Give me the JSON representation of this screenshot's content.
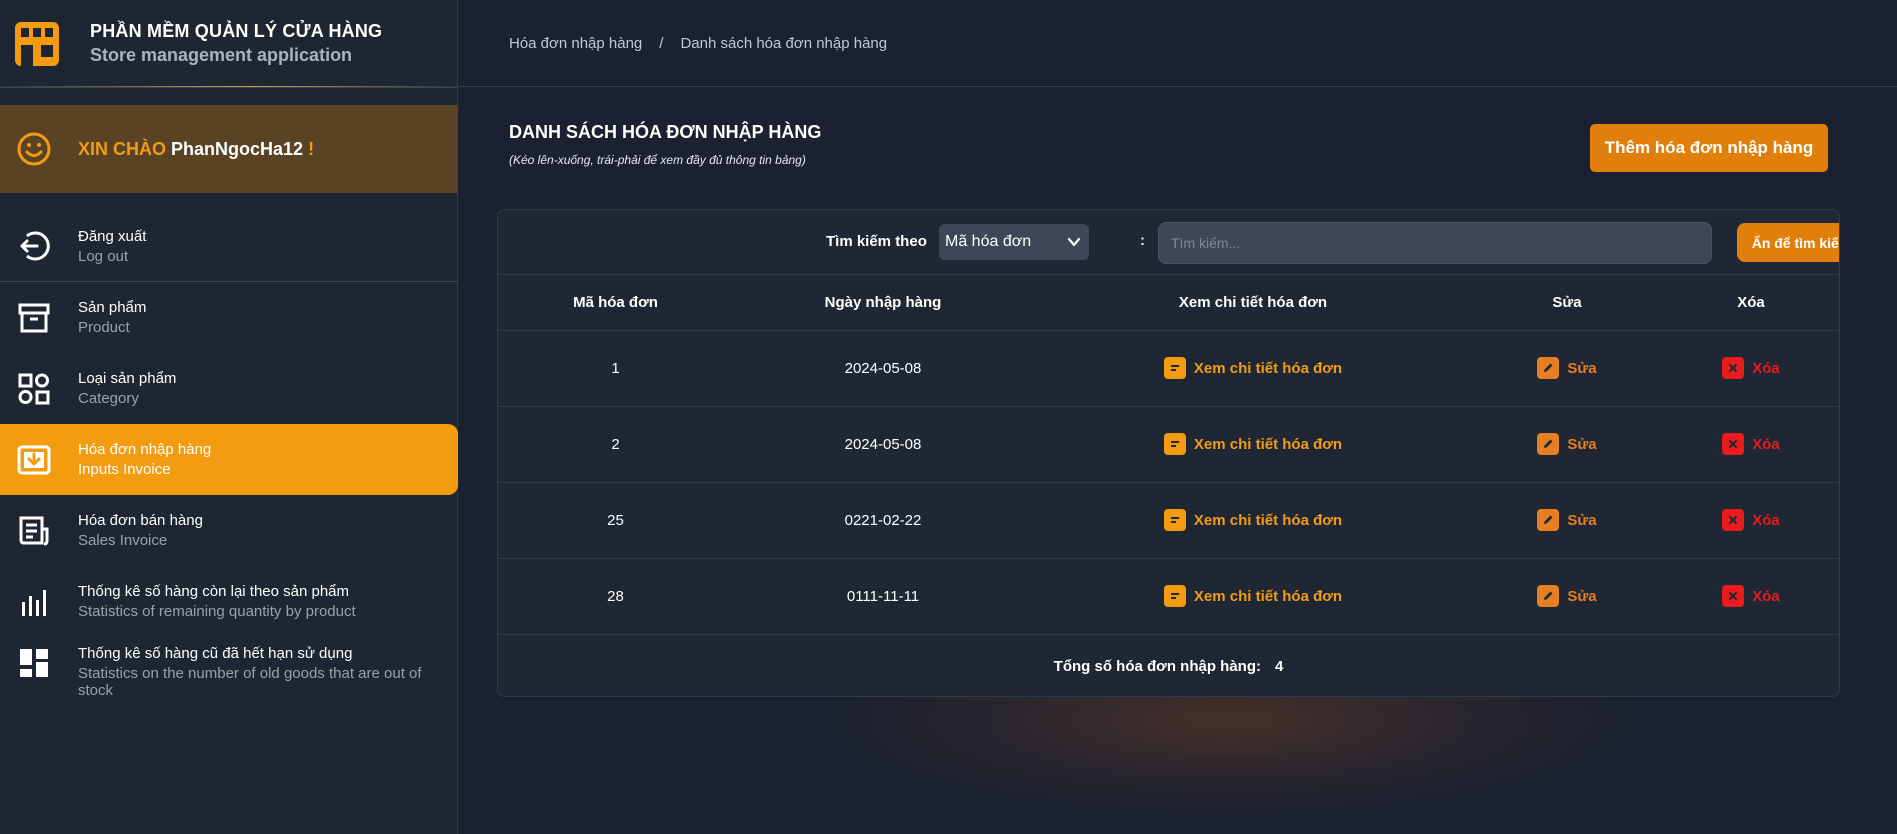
{
  "app": {
    "title": "PHẦN MỀM QUẢN LÝ CỬA HÀNG",
    "subtitle": "Store management application",
    "logo_icon": "store-icon",
    "accent": "#f39c12"
  },
  "greeting": {
    "hello": "XIN CHÀO",
    "username": "PhanNgocHa12",
    "bang": "!",
    "icon": "smiley-icon"
  },
  "sidebar": {
    "items": [
      {
        "label": "Đăng xuất",
        "sub": "Log out",
        "icon": "logout-icon"
      },
      {
        "label": "Sản phẩm",
        "sub": "Product",
        "icon": "archive-box-icon"
      },
      {
        "label": "Loại sản phẩm",
        "sub": "Category",
        "icon": "category-icon"
      },
      {
        "label": "Hóa đơn nhập hàng",
        "sub": "Inputs Invoice",
        "icon": "inbox-download-icon",
        "active": true
      },
      {
        "label": "Hóa đơn bán hàng",
        "sub": "Sales Invoice",
        "icon": "receipt-icon"
      },
      {
        "label": "Thống kê số hàng còn lại theo sản phẩm",
        "sub": "Statistics of remaining quantity by product",
        "icon": "bar-chart-icon"
      },
      {
        "label": "Thống kê số hàng cũ đã hết hạn sử dụng",
        "sub": "Statistics on the number of old goods that are out of stock",
        "icon": "dashboard-grid-icon"
      }
    ]
  },
  "breadcrumb": {
    "parent": "Hóa đơn nhập hàng",
    "separator": "/",
    "current": "Danh sách hóa đơn nhập hàng"
  },
  "page": {
    "title": "DANH SÁCH HÓA ĐƠN NHẬP HÀNG",
    "hint": "(Kéo lên-xuống, trái-phải để xem đầy đủ thông tin bảng)",
    "add_button": "Thêm hóa đơn nhập hàng"
  },
  "search": {
    "label": "Tìm kiếm theo",
    "selected": "Mã hóa đơn",
    "colon": ":",
    "placeholder": "Tìm kiếm...",
    "button": "Ấn để tìm kiếm"
  },
  "table": {
    "headers": [
      "Mã hóa đơn",
      "Ngày nhập hàng",
      "Xem chi tiết hóa đơn",
      "Sửa",
      "Xóa"
    ],
    "rows": [
      {
        "id": "1",
        "date": "2024-05-08",
        "view": "Xem chi tiết hóa đơn",
        "edit": "Sửa",
        "delete": "Xóa"
      },
      {
        "id": "2",
        "date": "2024-05-08",
        "view": "Xem chi tiết hóa đơn",
        "edit": "Sửa",
        "delete": "Xóa"
      },
      {
        "id": "25",
        "date": "0221-02-22",
        "view": "Xem chi tiết hóa đơn",
        "edit": "Sửa",
        "delete": "Xóa"
      },
      {
        "id": "28",
        "date": "0111-11-11",
        "view": "Xem chi tiết hóa đơn",
        "edit": "Sửa",
        "delete": "Xóa"
      }
    ],
    "total_label": "Tổng số hóa đơn nhập hàng:",
    "total_value": "4"
  },
  "colors": {
    "sidebar_bg": "#1e2633",
    "main_bg": "#1b2130",
    "greeting_bg": "#5a4224",
    "active_bg": "#f39c12",
    "delete_red": "#e81c1c"
  }
}
